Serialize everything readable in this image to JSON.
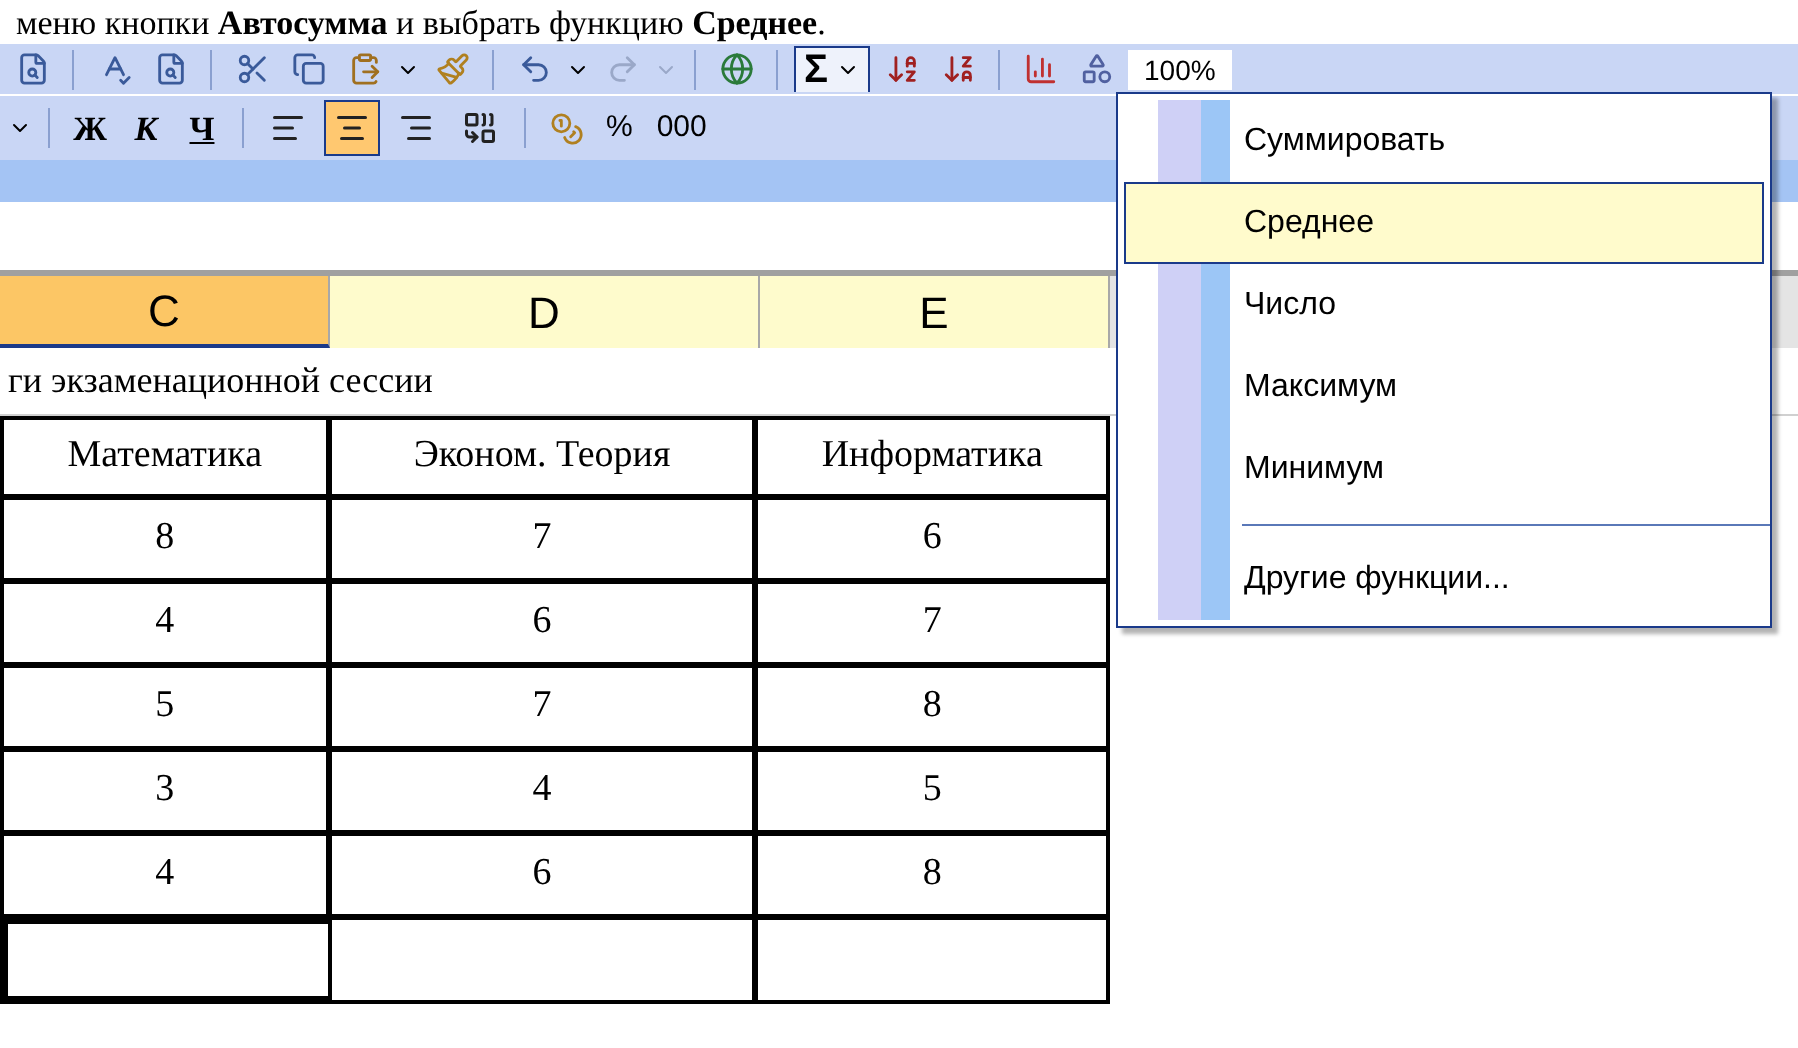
{
  "caption": "меню кнопки **Автосумма** и выбрать функцию **Среднее**.",
  "standard_toolbar": {
    "autosum": {
      "label": "Σ",
      "pressed": true
    },
    "zoom": "100%"
  },
  "formatting_toolbar": {
    "font_styles": [
      {
        "label": "Ж",
        "kind": "bold"
      },
      {
        "label": "К",
        "kind": "italic"
      },
      {
        "label": "Ч",
        "kind": "underline"
      }
    ],
    "alignment": [
      {
        "kind": "left",
        "selected": false
      },
      {
        "kind": "center",
        "selected": true
      },
      {
        "kind": "right",
        "selected": false
      },
      {
        "kind": "merge",
        "selected": false
      }
    ],
    "number_formats": [
      "%",
      "000"
    ]
  },
  "column_headers": [
    {
      "label": "C",
      "selected": true
    },
    {
      "label": "D",
      "selected": false
    },
    {
      "label": "E",
      "selected": false
    }
  ],
  "sheet_title": "ги экзаменационной сессии",
  "table": {
    "columns": [
      "Математика",
      "Эконом. Теория",
      "Информатика"
    ],
    "rows": [
      [
        "8",
        "7",
        "6"
      ],
      [
        "4",
        "6",
        "7"
      ],
      [
        "5",
        "7",
        "8"
      ],
      [
        "3",
        "4",
        "5"
      ],
      [
        "4",
        "6",
        "8"
      ]
    ]
  },
  "autosum_menu": [
    {
      "kind": "item",
      "label": "Суммировать",
      "selected": false
    },
    {
      "kind": "item",
      "label": "Среднее",
      "selected": true
    },
    {
      "kind": "item",
      "label": "Число",
      "selected": false
    },
    {
      "kind": "item",
      "label": "Максимум",
      "selected": false
    },
    {
      "kind": "item",
      "label": "Минимум",
      "selected": false
    },
    {
      "kind": "separator"
    },
    {
      "kind": "item",
      "label": "Другие функции...",
      "selected": false
    }
  ]
}
